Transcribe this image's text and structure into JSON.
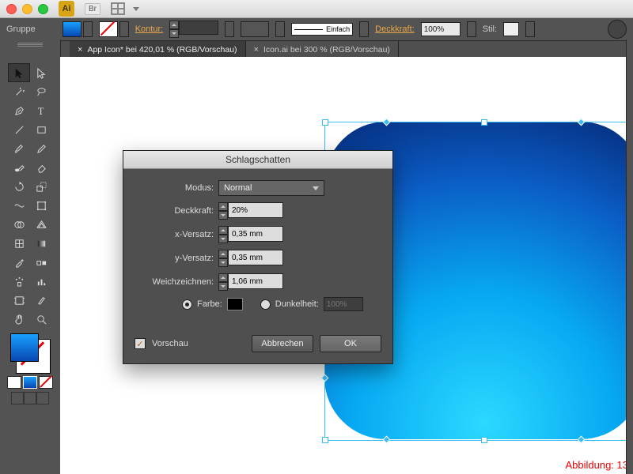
{
  "app_short": "Ai",
  "bridge_btn": "Br",
  "ctrl": {
    "group": "Gruppe",
    "stroke_label": "Kontur:",
    "strokestyle": "Einfach",
    "opacity_label": "Deckkraft:",
    "opacity_value": "100%",
    "style_label": "Stil:"
  },
  "tabs": [
    {
      "label": "App Icon* bei 420,01 % (RGB/Vorschau)",
      "active": true
    },
    {
      "label": "Icon.ai bei 300 % (RGB/Vorschau)",
      "active": false
    }
  ],
  "dialog": {
    "title": "Schlagschatten",
    "mode_label": "Modus:",
    "mode_value": "Normal",
    "opacity_label": "Deckkraft:",
    "opacity_value": "20%",
    "xoff_label": "x-Versatz:",
    "xoff_value": "0,35 mm",
    "yoff_label": "y-Versatz:",
    "yoff_value": "0,35 mm",
    "blur_label": "Weichzeichnen:",
    "blur_value": "1,06 mm",
    "color_label": "Farbe:",
    "dark_label": "Dunkelheit:",
    "dark_value": "100%",
    "preview_label": "Vorschau",
    "cancel": "Abbrechen",
    "ok": "OK"
  },
  "caption": "Abbildung: 13"
}
